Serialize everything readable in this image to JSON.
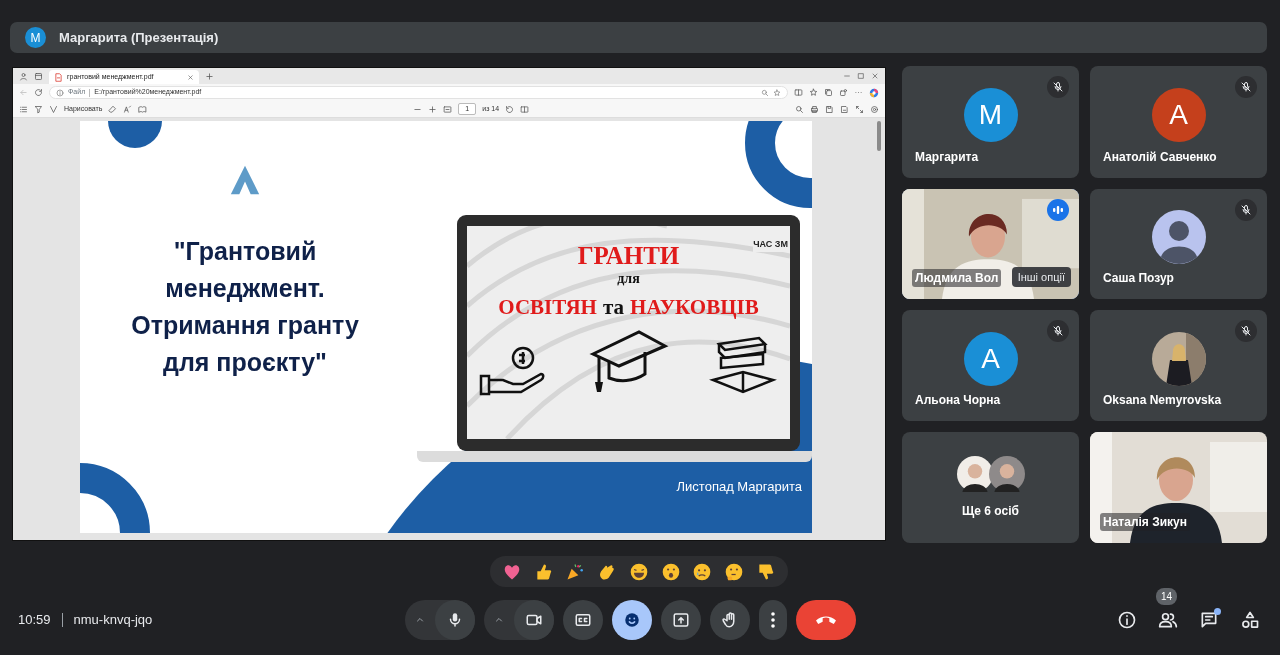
{
  "header": {
    "avatar": "M",
    "title": "Маргарита (Презентація)"
  },
  "browser": {
    "tab_title": "грантовий менеджмент.pdf",
    "address_label": "Файл",
    "address": "E:/грантовий%20менеджмент.pdf",
    "draw_tool": "Нарисовать",
    "page": "1",
    "page_total": "из 14"
  },
  "slide": {
    "title": "\"Грантовий менеджмент. Отримання гранту для проєкту\"",
    "screen_heading": "ГРАНТИ",
    "screen_sub": "для",
    "screen_line": [
      {
        "text": "ОСВІТЯН",
        "kind": "accent"
      },
      {
        "text": "та",
        "kind": "plain"
      },
      {
        "text": "НАУКОВЦІВ",
        "kind": "accent"
      }
    ],
    "screen_logo": "ЧАС ЗМ",
    "author": "Листопад Маргарита"
  },
  "participants": [
    {
      "name": "Маргарита",
      "kind": "avatar",
      "initial": "M",
      "color": "#1a8fd6",
      "muted": true,
      "speaking": false,
      "selected": false
    },
    {
      "name": "Анатолій Савченко",
      "kind": "avatar",
      "initial": "A",
      "color": "#c5401c",
      "muted": true,
      "speaking": false,
      "selected": false
    },
    {
      "name": "Людмила Вол",
      "kind": "video",
      "muted": false,
      "speaking": true,
      "selected": true,
      "tooltip": "Інші опції"
    },
    {
      "name": "Саша Позур",
      "kind": "silhouette",
      "muted": true,
      "speaking": false,
      "selected": false
    },
    {
      "name": "Альона Чорна",
      "kind": "avatar",
      "initial": "A",
      "color": "#1a8fd6",
      "muted": true,
      "speaking": false,
      "selected": false
    },
    {
      "name": "Oksana Nemyrovska",
      "muted": true,
      "speaking": false,
      "selected": false
    },
    {
      "name": "Ще 6 осіб",
      "kind": "more",
      "muted": false,
      "speaking": false,
      "selected": false
    },
    {
      "name": "Наталія Зикун",
      "kind": "video2",
      "muted": false,
      "speaking": false,
      "selected": false
    }
  ],
  "meeting": {
    "time": "10:59",
    "code": "nmu-knvq-jqo"
  },
  "controls": [
    {
      "kind": "mic",
      "caret": true,
      "selected": false
    },
    {
      "kind": "camera",
      "caret": true,
      "selected": false
    },
    {
      "kind": "captions",
      "caret": false,
      "selected": false
    },
    {
      "kind": "reactions",
      "caret": false,
      "selected": true
    },
    {
      "kind": "present",
      "caret": false,
      "selected": false
    },
    {
      "kind": "hand",
      "caret": false,
      "selected": false
    },
    {
      "kind": "more",
      "caret": false,
      "selected": false
    },
    {
      "kind": "end",
      "caret": false,
      "selected": false
    }
  ],
  "side_buttons": [
    {
      "kind": "info",
      "dot": false
    },
    {
      "kind": "people",
      "badge": "14",
      "dot": false
    },
    {
      "kind": "chat",
      "dot": true
    },
    {
      "kind": "activities",
      "dot": false
    }
  ]
}
